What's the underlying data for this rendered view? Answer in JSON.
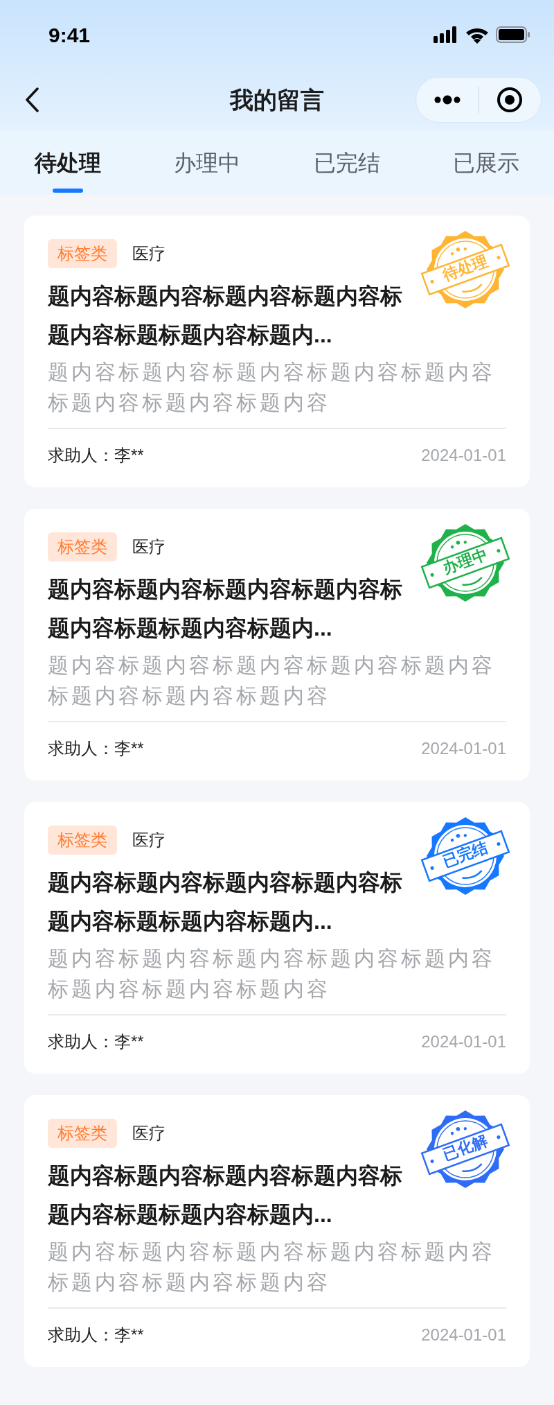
{
  "status_bar": {
    "time": "9:41"
  },
  "nav": {
    "title": "我的留言"
  },
  "tabs": [
    {
      "label": "待处理",
      "selected": true
    },
    {
      "label": "办理中",
      "selected": false
    },
    {
      "label": "已完结",
      "selected": false
    },
    {
      "label": "已展示",
      "selected": false
    }
  ],
  "cards": [
    {
      "tag": "标签类",
      "category": "医疗",
      "title": "题内容标题内容标题内容标题内容标题内容标题标题内容标题内...",
      "description": "题内容标题内容标题内容标题内容标题内容标题内容标题内容标题内容",
      "requester": "求助人：李**",
      "date": "2024-01-01",
      "stamp": {
        "label": "待处理",
        "color": "#ffb534"
      }
    },
    {
      "tag": "标签类",
      "category": "医疗",
      "title": "题内容标题内容标题内容标题内容标题内容标题标题内容标题内...",
      "description": "题内容标题内容标题内容标题内容标题内容标题内容标题内容标题内容",
      "requester": "求助人：李**",
      "date": "2024-01-01",
      "stamp": {
        "label": "办理中",
        "color": "#1fb14a"
      }
    },
    {
      "tag": "标签类",
      "category": "医疗",
      "title": "题内容标题内容标题内容标题内容标题内容标题标题内容标题内...",
      "description": "题内容标题内容标题内容标题内容标题内容标题内容标题内容标题内容",
      "requester": "求助人：李**",
      "date": "2024-01-01",
      "stamp": {
        "label": "已完结",
        "color": "#1677ff"
      }
    },
    {
      "tag": "标签类",
      "category": "医疗",
      "title": "题内容标题内容标题内容标题内容标题内容标题标题内容标题内...",
      "description": "题内容标题内容标题内容标题内容标题内容标题内容标题内容标题内容",
      "requester": "求助人：李**",
      "date": "2024-01-01",
      "stamp": {
        "label": "已化解",
        "color": "#2f6cf6"
      }
    }
  ]
}
